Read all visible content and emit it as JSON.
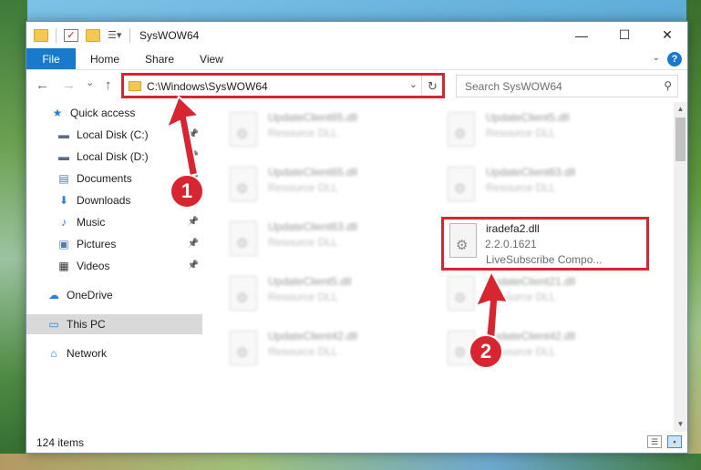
{
  "window": {
    "title": "SysWOW64",
    "controls": {
      "minimize": "—",
      "maximize": "☐",
      "close": "✕"
    }
  },
  "ribbon": {
    "tabs": [
      "File",
      "Home",
      "Share",
      "View"
    ],
    "help": "?"
  },
  "navigation": {
    "back": "←",
    "forward": "→",
    "recent": "⌄",
    "up": "↑",
    "address": "C:\\Windows\\SysWOW64",
    "refresh": "↻",
    "search_placeholder": "Search SysWOW64"
  },
  "sidebar": {
    "items": [
      {
        "label": "Quick access",
        "icon": "star-icon",
        "glyph": "★",
        "color": "#2b7fd6"
      },
      {
        "label": "Local Disk (C:)",
        "icon": "drive-icon",
        "glyph": "▬",
        "color": "#5d6c7d",
        "pinned": true
      },
      {
        "label": "Local Disk (D:)",
        "icon": "drive-icon",
        "glyph": "▬",
        "color": "#5d6c7d",
        "pinned": true
      },
      {
        "label": "Documents",
        "icon": "document-icon",
        "glyph": "▤",
        "color": "#4a7db3",
        "pinned": true
      },
      {
        "label": "Downloads",
        "icon": "download-icon",
        "glyph": "⬇",
        "color": "#2b7fd6",
        "pinned": true
      },
      {
        "label": "Music",
        "icon": "music-icon",
        "glyph": "♪",
        "color": "#2b7fd6",
        "pinned": true
      },
      {
        "label": "Pictures",
        "icon": "pictures-icon",
        "glyph": "▣",
        "color": "#4a7db3",
        "pinned": true
      },
      {
        "label": "Videos",
        "icon": "video-icon",
        "glyph": "▦",
        "color": "#333333",
        "pinned": true
      },
      {
        "label": "OneDrive",
        "icon": "cloud-icon",
        "glyph": "☁",
        "color": "#2b7fd6"
      },
      {
        "label": "This PC",
        "icon": "computer-icon",
        "glyph": "▭",
        "color": "#2b7fd6",
        "selected": true
      },
      {
        "label": "Network",
        "icon": "network-icon",
        "glyph": "⌂",
        "color": "#2b7fd6"
      }
    ]
  },
  "files": [
    {
      "name": "UpdateClient65.dll",
      "desc": "Resource DLL"
    },
    {
      "name": "UpdateClient5.dll",
      "desc": "Resource DLL"
    },
    {
      "name": "UpdateClient65.dll",
      "desc": "Resource DLL"
    },
    {
      "name": "UpdateClient63.dll",
      "desc": "Resource DLL"
    },
    {
      "name": "UpdateClient63.dll",
      "desc": "Resource DLL"
    },
    {
      "name": "iradefa2.dll",
      "version": "2.2.0.1621",
      "desc": "LiveSubscribe Compo...",
      "highlighted": true
    },
    {
      "name": "UpdateClient5.dll",
      "desc": "Resource DLL"
    },
    {
      "name": "UpdateClient21.dll",
      "desc": "Resource DLL"
    },
    {
      "name": "UpdateClient42.dll",
      "desc": "Resource DLL"
    },
    {
      "name": "UpdateClient42.dll",
      "desc": "Resource DLL"
    }
  ],
  "status": {
    "item_count": "124 items"
  },
  "annotations": {
    "step1": "1",
    "step2": "2",
    "color": "#d7262f"
  }
}
